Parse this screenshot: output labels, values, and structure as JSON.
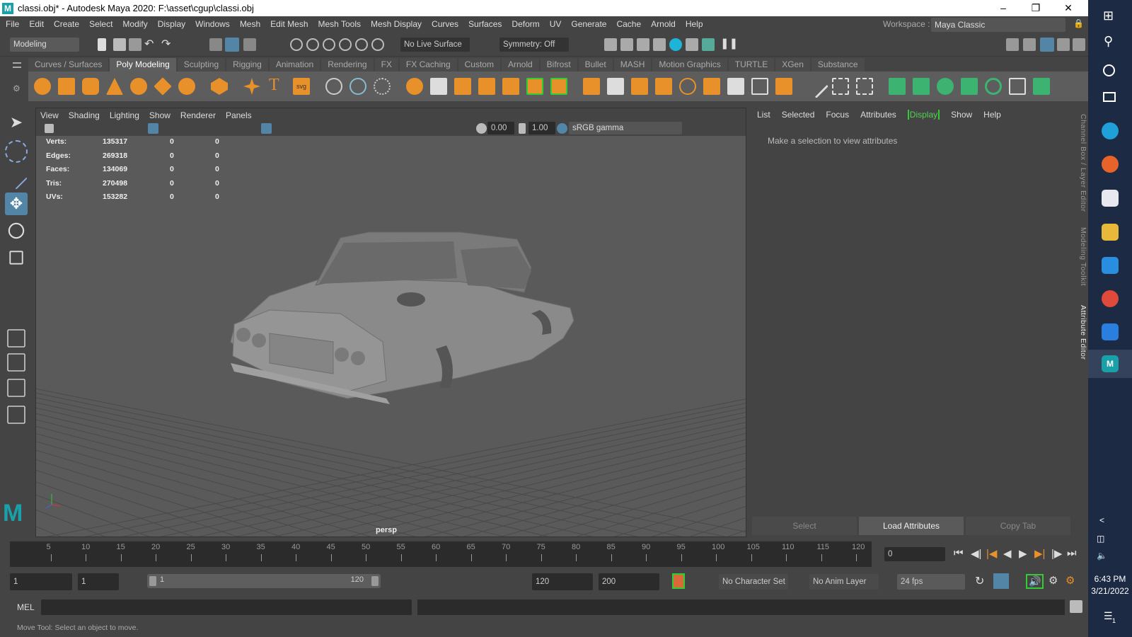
{
  "window": {
    "title": "classi.obj* - Autodesk Maya 2020: F:\\asset\\cgup\\classi.obj",
    "logo": "M"
  },
  "menus": [
    "File",
    "Edit",
    "Create",
    "Select",
    "Modify",
    "Display",
    "Windows",
    "Mesh",
    "Edit Mesh",
    "Mesh Tools",
    "Mesh Display",
    "Curves",
    "Surfaces",
    "Deform",
    "UV",
    "Generate",
    "Cache",
    "Arnold",
    "Help"
  ],
  "workspace": {
    "label": "Workspace :",
    "value": "Maya Classic"
  },
  "statusline": {
    "menuset": "Modeling",
    "live_surface": "No Live Surface",
    "symmetry": "Symmetry: Off"
  },
  "shelf_tabs": [
    "Curves / Surfaces",
    "Poly Modeling",
    "Sculpting",
    "Rigging",
    "Animation",
    "Rendering",
    "FX",
    "FX Caching",
    "Custom",
    "Arnold",
    "Bifrost",
    "Bullet",
    "MASH",
    "Motion Graphics",
    "TURTLE",
    "XGen",
    "Substance"
  ],
  "shelf_active": "Poly Modeling",
  "viewport": {
    "menus": [
      "View",
      "Shading",
      "Lighting",
      "Show",
      "Renderer",
      "Panels"
    ],
    "exposure": "0.00",
    "gamma": "1.00",
    "color_space": "sRGB gamma",
    "camera": "persp",
    "hud": [
      {
        "label": "Verts:",
        "a": "135317",
        "b": "0",
        "c": "0"
      },
      {
        "label": "Edges:",
        "a": "269318",
        "b": "0",
        "c": "0"
      },
      {
        "label": "Faces:",
        "a": "134069",
        "b": "0",
        "c": "0"
      },
      {
        "label": "Tris:",
        "a": "270498",
        "b": "0",
        "c": "0"
      },
      {
        "label": "UVs:",
        "a": "153282",
        "b": "0",
        "c": "0"
      }
    ]
  },
  "attribute_editor": {
    "menus": [
      "List",
      "Selected",
      "Focus",
      "Attributes",
      "Display",
      "Show",
      "Help"
    ],
    "message": "Make a selection to view attributes",
    "buttons": [
      "Select",
      "Load Attributes",
      "Copy Tab"
    ],
    "side_tabs": [
      "Channel Box / Layer Editor",
      "Modeling Toolkit",
      "Attribute Editor"
    ]
  },
  "timeline": {
    "ticks": [
      "5",
      "10",
      "15",
      "20",
      "25",
      "30",
      "35",
      "40",
      "45",
      "50",
      "55",
      "60",
      "65",
      "70",
      "75",
      "80",
      "85",
      "90",
      "95",
      "100",
      "105",
      "110",
      "115",
      "120"
    ],
    "current_frame": "0"
  },
  "range": {
    "start": "1",
    "playback_start": "1",
    "slider_start": "1",
    "slider_end": "120",
    "playback_end": "120",
    "end": "200",
    "character_set": "No Character Set",
    "anim_layer": "No Anim Layer",
    "fps": "24 fps"
  },
  "command_line": {
    "label": "MEL"
  },
  "help_line": "Move Tool: Select an object to move.",
  "taskbar": {
    "time": "6:43 PM",
    "date": "3/21/2022",
    "notifications": "1"
  },
  "colors": {
    "accent": "#5285a6",
    "active_green": "#54d154",
    "taskbar": "#1c2a44"
  }
}
